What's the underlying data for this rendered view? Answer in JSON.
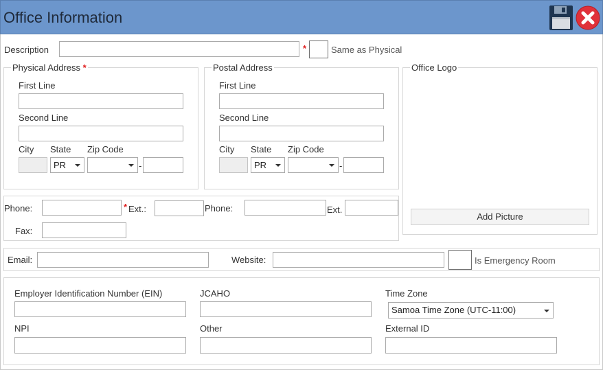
{
  "window": {
    "title": "Office Information"
  },
  "description": {
    "label": "Description",
    "value": "",
    "required_mark": "*",
    "same_as_physical_label": "Same as Physical"
  },
  "physical_address": {
    "legend": "Physical Address",
    "required_mark": "*",
    "first_line_label": "First Line",
    "first_line_value": "",
    "second_line_label": "Second Line",
    "second_line_value": "",
    "city_label": "City",
    "city_value": "",
    "state_label": "State",
    "state_value": "PR",
    "zip_label": "Zip Code",
    "zip_value": "",
    "zip_sep": "-",
    "zip_ext_value": ""
  },
  "postal_address": {
    "legend": "Postal Address",
    "first_line_label": "First Line",
    "first_line_value": "",
    "second_line_label": "Second Line",
    "second_line_value": "",
    "city_label": "City",
    "city_value": "",
    "state_label": "State",
    "state_value": "PR",
    "zip_label": "Zip Code",
    "zip_value": "",
    "zip_sep": "-",
    "zip_ext_value": ""
  },
  "office_logo": {
    "legend": "Office Logo",
    "add_picture_label": "Add Picture"
  },
  "phones": {
    "phone1_label": "Phone:",
    "phone1_value": "",
    "required_mark": "*",
    "ext1_label": "Ext.:",
    "ext1_value": "",
    "phone2_label": "Phone:",
    "phone2_value": "",
    "ext2_label": "Ext.",
    "ext2_value": "",
    "fax_label": "Fax:",
    "fax_value": ""
  },
  "contact": {
    "email_label": "Email:",
    "email_value": "",
    "website_label": "Website:",
    "website_value": "",
    "emergency_label": "Is Emergency Room"
  },
  "identifiers": {
    "ein_label": "Employer Identification Number (EIN)",
    "ein_value": "",
    "jcaho_label": "JCAHO",
    "jcaho_value": "",
    "timezone_label": "Time Zone",
    "timezone_value": "Samoa Time Zone (UTC-11:00)",
    "npi_label": "NPI",
    "npi_value": "",
    "other_label": "Other",
    "other_value": "",
    "external_id_label": "External ID",
    "external_id_value": ""
  },
  "colors": {
    "titlebar": "#6c96cc",
    "required": "#e02020",
    "close": "#e0313a"
  }
}
